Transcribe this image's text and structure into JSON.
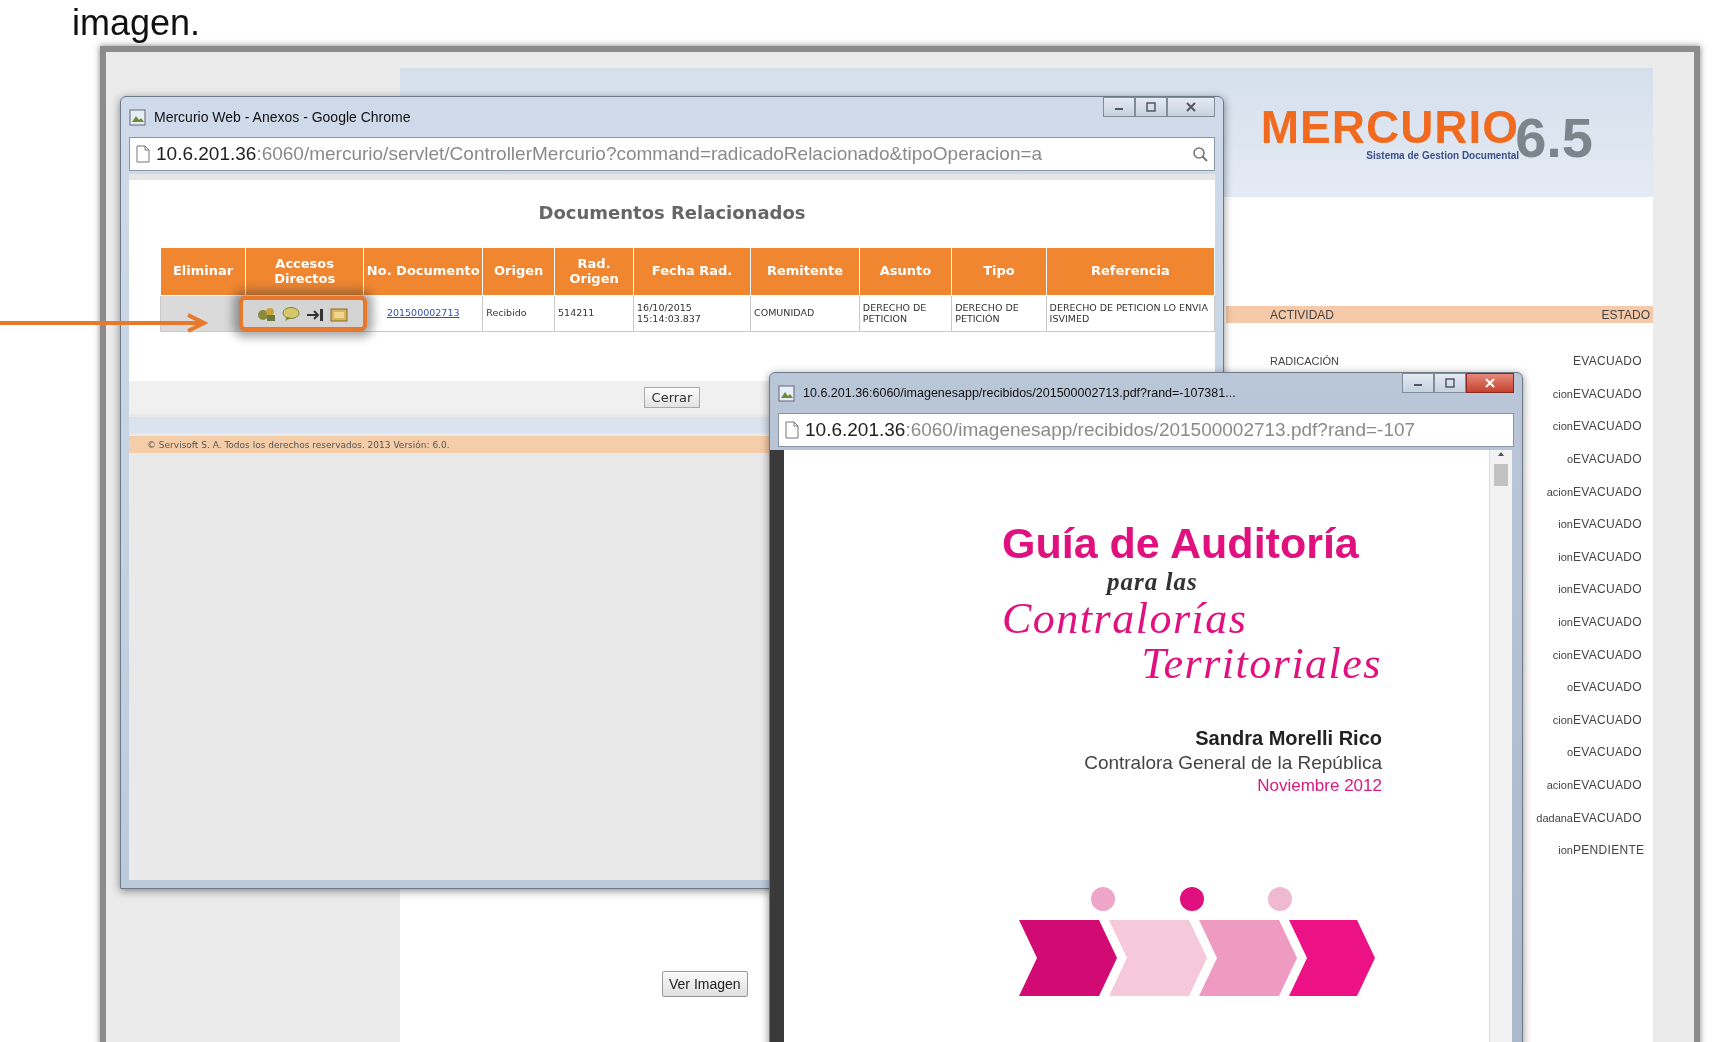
{
  "caption": "imagen.",
  "app": {
    "logo": {
      "name": "MERCURIO",
      "subtitle": "Sistema de Gestion Documental",
      "version": "6.5"
    },
    "activity_table": {
      "columns": [
        "ACTIVIDAD",
        "ESTADO"
      ],
      "rows": [
        {
          "actividad": "RADICACIÓN",
          "estado": "EVACUADO"
        },
        {
          "actividad": "cion",
          "estado": "EVACUADO"
        },
        {
          "actividad": "cion",
          "estado": "EVACUADO"
        },
        {
          "actividad": "o",
          "estado": "EVACUADO"
        },
        {
          "actividad": "acion",
          "estado": "EVACUADO"
        },
        {
          "actividad": "ion",
          "estado": "EVACUADO"
        },
        {
          "actividad": "ion",
          "estado": "EVACUADO"
        },
        {
          "actividad": "ion",
          "estado": "EVACUADO"
        },
        {
          "actividad": "ion",
          "estado": "EVACUADO"
        },
        {
          "actividad": "cion",
          "estado": "EVACUADO"
        },
        {
          "actividad": "o",
          "estado": "EVACUADO"
        },
        {
          "actividad": "cion",
          "estado": "EVACUADO"
        },
        {
          "actividad": "o",
          "estado": "EVACUADO"
        },
        {
          "actividad": "acion",
          "estado": "EVACUADO"
        },
        {
          "actividad": "dadana",
          "estado": "EVACUADO"
        },
        {
          "actividad": "ion",
          "estado": "PENDIENTE"
        }
      ]
    },
    "button": "Ver Imagen"
  },
  "annexes_window": {
    "title": "Mercurio Web - Anexos - Google Chrome",
    "address_host": "10.6.201.36",
    "address_rest": ":6060/mercurio/servlet/ControllerMercurio?command=radicadoRelacionado&tipoOperacion=a",
    "heading": "Documentos Relacionados",
    "columns": [
      "Eliminar",
      "Accesos Directos",
      "No. Documento",
      "Origen",
      "Rad. Origen",
      "Fecha Rad.",
      "Remitente",
      "Asunto",
      "Tipo",
      "Referencia"
    ],
    "rows": [
      {
        "documento": "201500002713",
        "origen": "Recibido",
        "rad_origen": "514211",
        "fecha": "16/10/2015 15:14:03.837",
        "remitente": "COMUNIDAD",
        "asunto": "DERECHO DE PETICION",
        "tipo": "DERECHO DE PETICIÓN",
        "referencia": "DERECHO DE PETICION LO ENVIA ISVIMED"
      }
    ],
    "button": "Cerrar",
    "footer": "© Servisoft S. A. Todos los derechos reservados. 2013 Versión: 6.0."
  },
  "pdf_window": {
    "title": "10.6.201.36:6060/imagenesapp/recibidos/201500002713.pdf?rand=-107381...",
    "address_host": "10.6.201.36",
    "address_rest": ":6060/imagenesapp/recibidos/201500002713.pdf?rand=-107",
    "document": {
      "title": "Guía de Auditoría",
      "subtitle": "para las",
      "title_line2": "Contralorías",
      "title_line3": "Territoriales",
      "author": "Sandra Morelli Rico",
      "role": "Contralora General de la República",
      "date": "Noviembre 2012"
    }
  }
}
